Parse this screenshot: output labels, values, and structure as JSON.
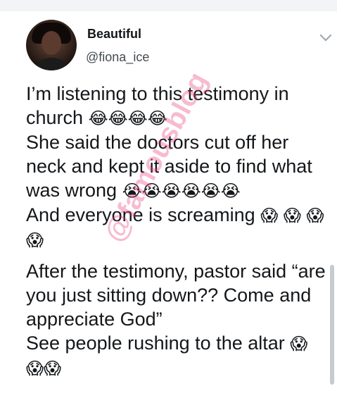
{
  "profile": {
    "name": "Beautiful",
    "handle": "@fiona_ice"
  },
  "tweet": {
    "line1": "I’m listening to this testimony in church",
    "emoji1": "😂😂😂😂",
    "line2": "She said the doctors cut off her neck and kept it aside to find what was wrong",
    "emoji2": "😭😭😭😭😭😭",
    "line3": "And everyone is screaming",
    "emoji3": "😱 😱 😱😱",
    "line4": "After the testimony, pastor said “are you just sitting down?? Come and appreciate God”",
    "line5": "See people rushing to the altar",
    "emoji5": "😱 😱😱"
  },
  "watermark": "@famousblog"
}
